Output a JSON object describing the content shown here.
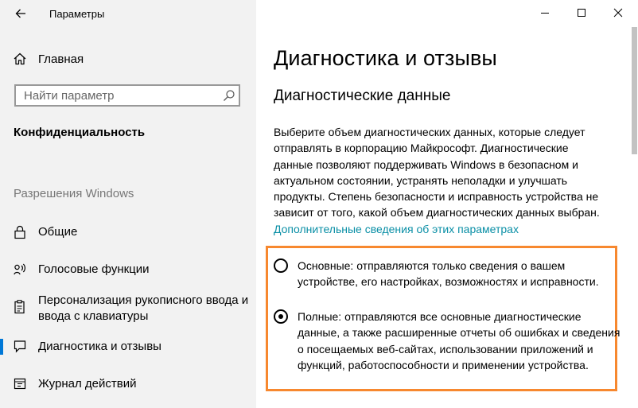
{
  "window": {
    "title": "Параметры",
    "back_icon": "arrow-left-icon"
  },
  "sidebar": {
    "home_label": "Главная",
    "search_placeholder": "Найти параметр",
    "section_title": "Конфиденциальность",
    "group_header": "Разрешения Windows",
    "items": [
      {
        "label": "Общие",
        "icon": "lock-icon"
      },
      {
        "label": "Голосовые функции",
        "icon": "speech-icon"
      },
      {
        "label": "Персонализация рукописного ввода и ввода с клавиатуры",
        "icon": "clipboard-icon"
      },
      {
        "label": "Диагностика и отзывы",
        "icon": "feedback-icon",
        "active": true
      },
      {
        "label": "Журнал действий",
        "icon": "history-icon"
      }
    ]
  },
  "main": {
    "title": "Диагностика и отзывы",
    "section_title": "Диагностические данные",
    "description": "Выберите объем диагностических данных, которые следует отправлять в корпорацию Майкрософт. Диагностические данные позволяют поддерживать Windows в безопасном и актуальном состоянии, устранять неполадки и улучшать продукты. Степень безопасности и исправность устройства не зависит от того, какой объем диагностических данных выбран.",
    "link_text": "Дополнительные сведения об этих параметрах",
    "options": [
      {
        "label": "Основные: отправляются только сведения о вашем устройстве, его настройках, возможностях и исправности.",
        "selected": false
      },
      {
        "label": "Полные: отправляются все основные диагностические данные, а также расширенные отчеты об ошибках и сведения о посещаемых веб-сайтах, использовании приложений и функций, работоспособности и применении устройства.",
        "selected": true
      }
    ]
  },
  "colors": {
    "accent": "#0078d7",
    "link": "#0a8fa6",
    "highlight_border": "#f7882f",
    "sidebar_bg": "#f2f2f2"
  }
}
